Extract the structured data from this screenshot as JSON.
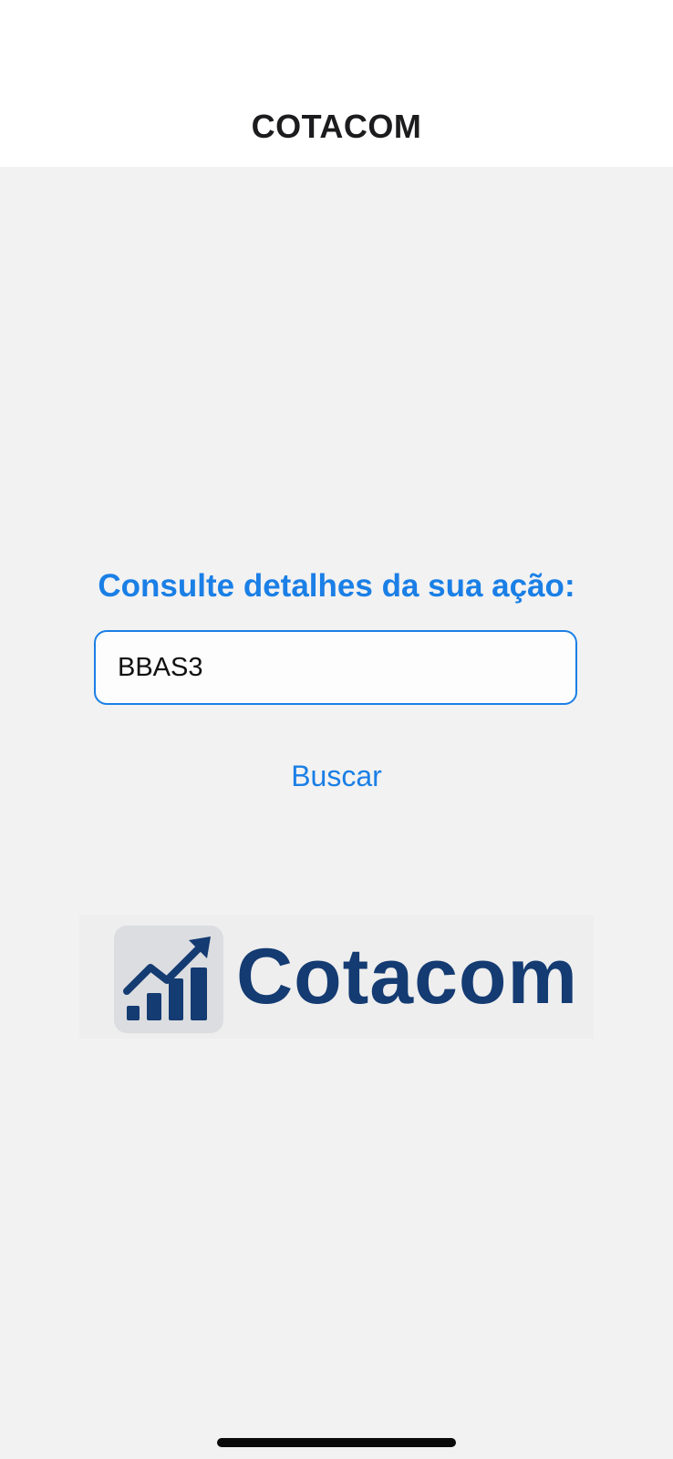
{
  "nav": {
    "title": "COTACOM"
  },
  "main": {
    "prompt": "Consulte detalhes da sua ação:",
    "ticker_input": {
      "value": "BBAS3",
      "placeholder": ""
    },
    "search_button_label": "Buscar"
  },
  "logo": {
    "text": "Cotacom",
    "icon": "growth-chart-icon"
  },
  "colors": {
    "accent": "#1a7fe6",
    "brand": "#143b72",
    "background": "#f2f2f2",
    "nav_background": "#ffffff"
  }
}
